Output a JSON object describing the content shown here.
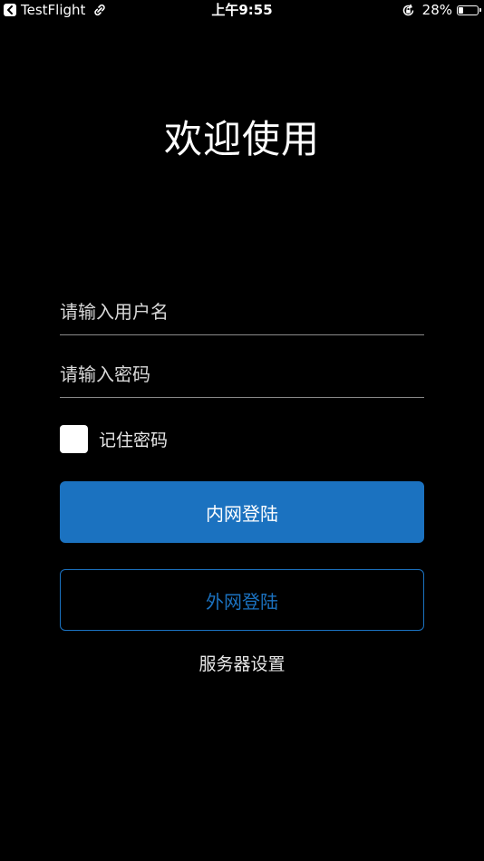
{
  "status_bar": {
    "back_app": "TestFlight",
    "time": "上午9:55",
    "battery_percent": "28%",
    "battery_level": 0.28
  },
  "login": {
    "title": "欢迎使用",
    "username_placeholder": "请输入用户名",
    "password_placeholder": "请输入密码",
    "remember_label": "记住密码",
    "remember_checked": false,
    "intranet_button": "内网登陆",
    "extranet_button": "外网登陆",
    "server_settings": "服务器设置"
  },
  "colors": {
    "background": "#000000",
    "accent": "#1b72c0",
    "text": "#ffffff"
  },
  "icons": {
    "back": "back-arrow-icon",
    "link": "link-icon",
    "orientation_lock": "orientation-lock-icon",
    "battery": "battery-icon"
  }
}
